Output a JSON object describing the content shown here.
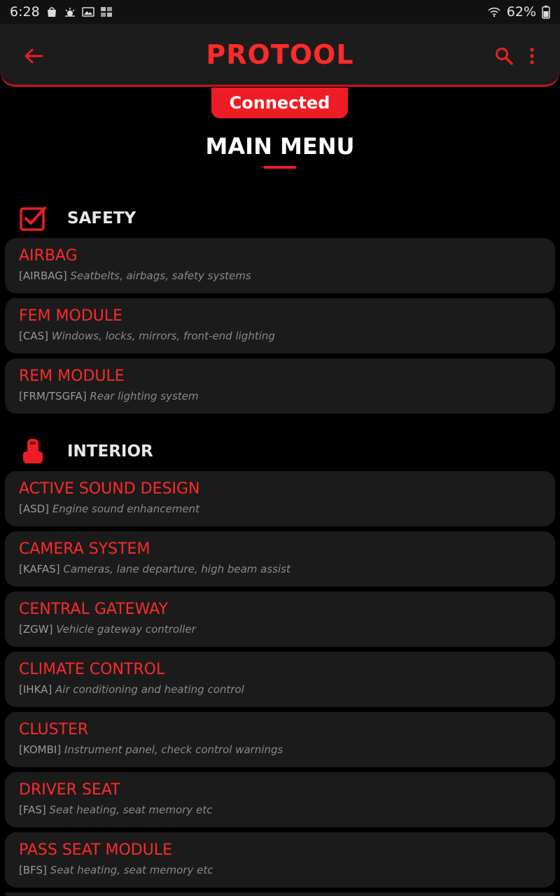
{
  "status_bar": {
    "time": "6:28",
    "battery": "62%"
  },
  "app_bar": {
    "title": "PROTOOL"
  },
  "connection": {
    "status": "Connected"
  },
  "page": {
    "title": "MAIN MENU"
  },
  "sections": [
    {
      "label": "SAFETY",
      "icon": "checkbox-icon",
      "items": [
        {
          "title": "AIRBAG",
          "code": "[AIRBAG]",
          "desc": "Seatbelts, airbags, safety systems"
        },
        {
          "title": "FEM MODULE",
          "code": "[CAS]",
          "desc": "Windows, locks, mirrors, front-end lighting"
        },
        {
          "title": "REM MODULE",
          "code": "[FRM/TSGFA]",
          "desc": "Rear lighting system"
        }
      ]
    },
    {
      "label": "INTERIOR",
      "icon": "car-seat-icon",
      "items": [
        {
          "title": "ACTIVE SOUND DESIGN",
          "code": "[ASD]",
          "desc": "Engine sound enhancement"
        },
        {
          "title": "CAMERA SYSTEM",
          "code": "[KAFAS]",
          "desc": "Cameras, lane departure, high beam assist"
        },
        {
          "title": "CENTRAL GATEWAY",
          "code": "[ZGW]",
          "desc": "Vehicle gateway controller"
        },
        {
          "title": "CLIMATE CONTROL",
          "code": "[IHKA]",
          "desc": "Air conditioning and heating control"
        },
        {
          "title": "CLUSTER",
          "code": "[KOMBI]",
          "desc": "Instrument panel, check control warnings"
        },
        {
          "title": "DRIVER SEAT",
          "code": "[FAS]",
          "desc": "Seat heating, seat memory etc"
        },
        {
          "title": "PASS SEAT MODULE",
          "code": "[BFS]",
          "desc": "Seat heating, seat memory etc"
        }
      ]
    }
  ],
  "colors": {
    "accent": "#ee1c24",
    "title_red": "#ff2a2a",
    "card_bg": "#1b1b1b",
    "app_bar_bg": "#1c1c1c"
  }
}
